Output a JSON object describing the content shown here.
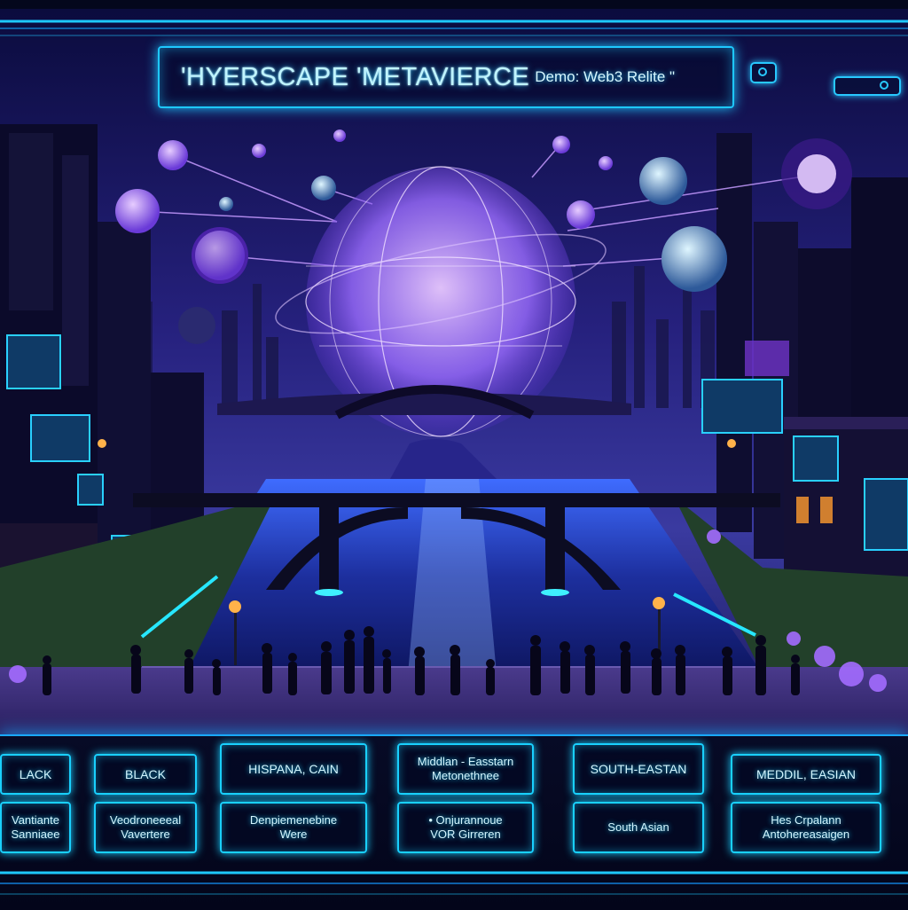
{
  "window": {
    "title": "'HYERSCAPE 'METAVIERCE",
    "subtitle": "Demo: Web3 Relite \""
  },
  "hud": {
    "icons": [
      "camera-icon",
      "headset-icon"
    ]
  },
  "colors": {
    "accent": "#1ec8ff",
    "glow": "#a45cff",
    "sky": "#1a1a78",
    "lamp": "#ff9b2e"
  },
  "categories": [
    {
      "heading": "LACK",
      "detail": "Vantiante\nSanniaee"
    },
    {
      "heading": "BLACK",
      "detail": "Veodroneeeal\nVavertere"
    },
    {
      "heading": "HISPANA, CAIN",
      "detail": "Denpiemenebine\nWere"
    },
    {
      "heading": "Middlan - Easstarn\nMetonethnee",
      "detail": "• Onjurannoue\nVOR Girreren"
    },
    {
      "heading": "SOUTH-EASTAN",
      "detail": "South Asian"
    },
    {
      "heading": "MEDDIL, EASIAN",
      "detail": "Hes Crpalann\nAntohereasaigen"
    }
  ]
}
